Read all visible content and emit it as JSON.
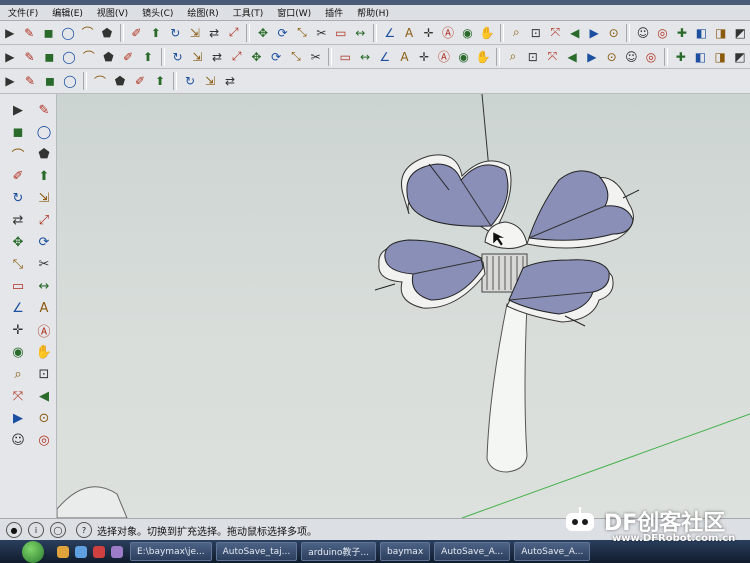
{
  "menu": [
    "文件(F)",
    "编辑(E)",
    "视图(V)",
    "镜头(C)",
    "绘图(R)",
    "工具(T)",
    "窗口(W)",
    "插件",
    "帮助(H)"
  ],
  "toolbar_row1": [
    "select",
    "paint",
    "eraser",
    "rectangle",
    "line",
    "circle",
    "arc",
    "polygon",
    "freehand",
    "push-pull",
    "follow-me",
    "offset",
    "move",
    "rotate",
    "scale",
    "intersect",
    "tape",
    "dimension",
    "protractor",
    "text",
    "axes",
    "3d-text",
    "orbit",
    "pan",
    "zoom",
    "zoom-window",
    "zoom-extents",
    "previous",
    "next",
    "position-camera",
    "walk",
    "look-around",
    "section",
    "iso",
    "top",
    "front",
    "right",
    "back",
    "left",
    "bottom",
    "xray",
    "wireframe",
    "hidden",
    "shaded",
    "textured",
    "monochrome",
    "component",
    "box",
    "cylinder",
    "cone",
    "sphere",
    "tube"
  ],
  "toolbar_row2": [
    "line-tool",
    "arc-tool",
    "rect-tool",
    "circle-tool",
    "polygon-tool",
    "star-tool",
    "spline-tool",
    "helix-tool",
    "shape-a",
    "shape-b",
    "shape-c",
    "shape-d",
    "shape-e",
    "grid-tool",
    "scale-tool",
    "array-tool",
    "mirror-tool",
    "rotate-copy",
    "trim-tool",
    "extend-tool",
    "fillet-tool",
    "chamfer-tool",
    "weld-tool",
    "split-tool",
    "join-tool",
    "loft-tool",
    "sweep-tool",
    "extrude-tool",
    "smooth-tool",
    "soften-tool",
    "drape-tool",
    "stamp-tool",
    "flip-tool",
    "cut-tool",
    "fill-tool",
    "unfold-tool",
    "shell-tool",
    "clean-tool",
    "layer-tool",
    "group-tool"
  ],
  "toolbar_row3": [
    "rotate-tool",
    "line-draw",
    "loop-tool",
    "pencil-tool",
    "refresh-tool",
    "hand-tool",
    "ellipse-tool",
    "cube-tool",
    "curve-tool",
    "shape-tool",
    "delete-tool"
  ],
  "left_toolbar": [
    "select",
    "component",
    "paint",
    "eraser",
    "rectangle",
    "line",
    "circle",
    "arc",
    "polygon",
    "freehand",
    "move",
    "push-pull",
    "rotate",
    "follow-me",
    "scale",
    "offset",
    "tape",
    "dimension",
    "protractor",
    "text",
    "axes",
    "3d-text",
    "orbit",
    "pan",
    "zoom",
    "zoom-window",
    "previous",
    "zoom-extents",
    "position-camera",
    "walk",
    "look-around",
    "section"
  ],
  "status": {
    "icons": [
      "geo-icon",
      "credit-icon",
      "user-icon"
    ],
    "text": "选择对象。切换到扩充选择。拖动鼠标选择多项。"
  },
  "taskbar": {
    "items": [
      "E:\\baymax\\je...",
      "AutoSave_taj...",
      "arduino教子...",
      "baymax",
      "AutoSave_A...",
      "AutoSave_A..."
    ]
  },
  "watermark": {
    "brand": "DF创客社区",
    "url": "www.DFRobot.com.cn"
  },
  "colors": {
    "petal_fill": "#8a8fb8",
    "model_edge": "#ffffff",
    "green_axis": "#43b04a",
    "viewport_bg": "#d3dad7"
  }
}
